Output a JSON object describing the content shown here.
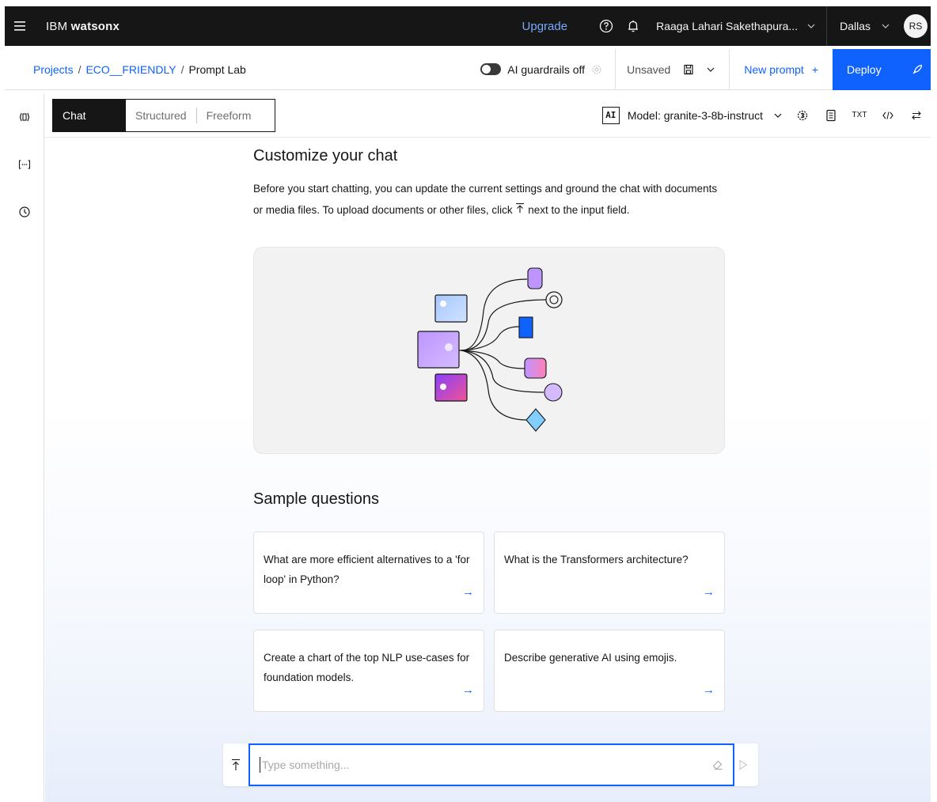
{
  "header": {
    "brand_light": "IBM",
    "brand_bold": "watsonx",
    "upgrade": "Upgrade",
    "user_name": "Raaga Lahari Sakethapura...",
    "region": "Dallas",
    "avatar_initials": "RS"
  },
  "subbar": {
    "breadcrumb": [
      "Projects",
      "ECO__FRIENDLY",
      "Prompt Lab"
    ],
    "separator": "/",
    "guardrails": "AI guardrails off",
    "unsaved": "Unsaved",
    "new_prompt": "New prompt",
    "new_prompt_icon": "+",
    "deploy": "Deploy"
  },
  "toolbar": {
    "modes": [
      "Chat",
      "Structured",
      "Freeform"
    ],
    "active_mode": "Chat",
    "ai_badge": "AI",
    "model": "Model: granite-3-8b-instruct",
    "txt_label": "TXT"
  },
  "main": {
    "title": "Customize your chat",
    "intro_part1": "Before you start chatting, you can update the current settings and ground the chat with documents or media files. To upload documents or other files, click",
    "intro_part2": "next to the input field.",
    "sample_title": "Sample questions",
    "samples": [
      "What are more efficient alternatives to a 'for loop' in Python?",
      "What is the Transformers architecture?",
      "Create a chart of the top NLP use-cases for foundation models.",
      "Describe generative AI using emojis."
    ],
    "arrow": "→"
  },
  "input": {
    "placeholder": "Type something..."
  },
  "colors": {
    "accent": "#0f62fe",
    "header_bg": "#161616"
  }
}
